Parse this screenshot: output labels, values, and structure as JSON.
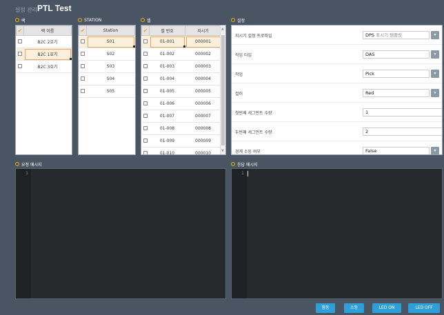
{
  "header": {
    "breadcrumb": "설정 관리",
    "title": "PTL Test"
  },
  "rack": {
    "label": "랙",
    "column": "랙 이름",
    "rows": [
      "B2C 2호기",
      "B2C 1호기",
      "B2C 3호기"
    ],
    "selected_index": 1
  },
  "station": {
    "label": "STATION",
    "column": "Station",
    "rows": [
      "S01",
      "S02",
      "S03",
      "S04",
      "S05"
    ],
    "selected_index": 0
  },
  "cell": {
    "label": "셀",
    "columns": [
      "셀 번호",
      "지시기"
    ],
    "rows": [
      [
        "01-001",
        "000001"
      ],
      [
        "01-002",
        "000002"
      ],
      [
        "01-003",
        "000003"
      ],
      [
        "01-004",
        "000004"
      ],
      [
        "01-005",
        "000005"
      ],
      [
        "01-006",
        "000006"
      ],
      [
        "01-007",
        "000007"
      ],
      [
        "01-008",
        "000008"
      ],
      [
        "01-009",
        "000009"
      ],
      [
        "01-010",
        "000010"
      ]
    ],
    "selected_index": 0
  },
  "settings": {
    "label": "설정",
    "rows": [
      {
        "label": "지시기 설정 프로파일",
        "value": "DPS",
        "hint": " 표시기 템플릿",
        "type": "dropdown"
      },
      {
        "label": "작업 타입",
        "value": "DAS",
        "hint": "",
        "type": "dropdown"
      },
      {
        "label": "작업",
        "value": "Pick",
        "hint": "",
        "type": "dropdown"
      },
      {
        "label": "컬러",
        "value": "Red",
        "hint": "",
        "type": "dropdown"
      },
      {
        "label": "첫번째 세그먼트 수량",
        "value": "1",
        "hint": "",
        "type": "text"
      },
      {
        "label": "두번째 세그먼트 수량",
        "value": "2",
        "hint": "",
        "type": "text"
      },
      {
        "label": "경계 소등 여부",
        "value": "False",
        "hint": "",
        "type": "dropdown"
      }
    ]
  },
  "request": {
    "label": "요청 메시지",
    "line": "1"
  },
  "response": {
    "label": "응답 메시지",
    "line": "1"
  },
  "buttons": {
    "on": "점등",
    "off": "소등",
    "led_on": "LED ON",
    "led_off": "LED OFF"
  },
  "colors": {
    "accent": "#2f9fd8",
    "background": "#4a5563",
    "selected_row": "#fbeedb",
    "section_dot": "#f0b400"
  }
}
